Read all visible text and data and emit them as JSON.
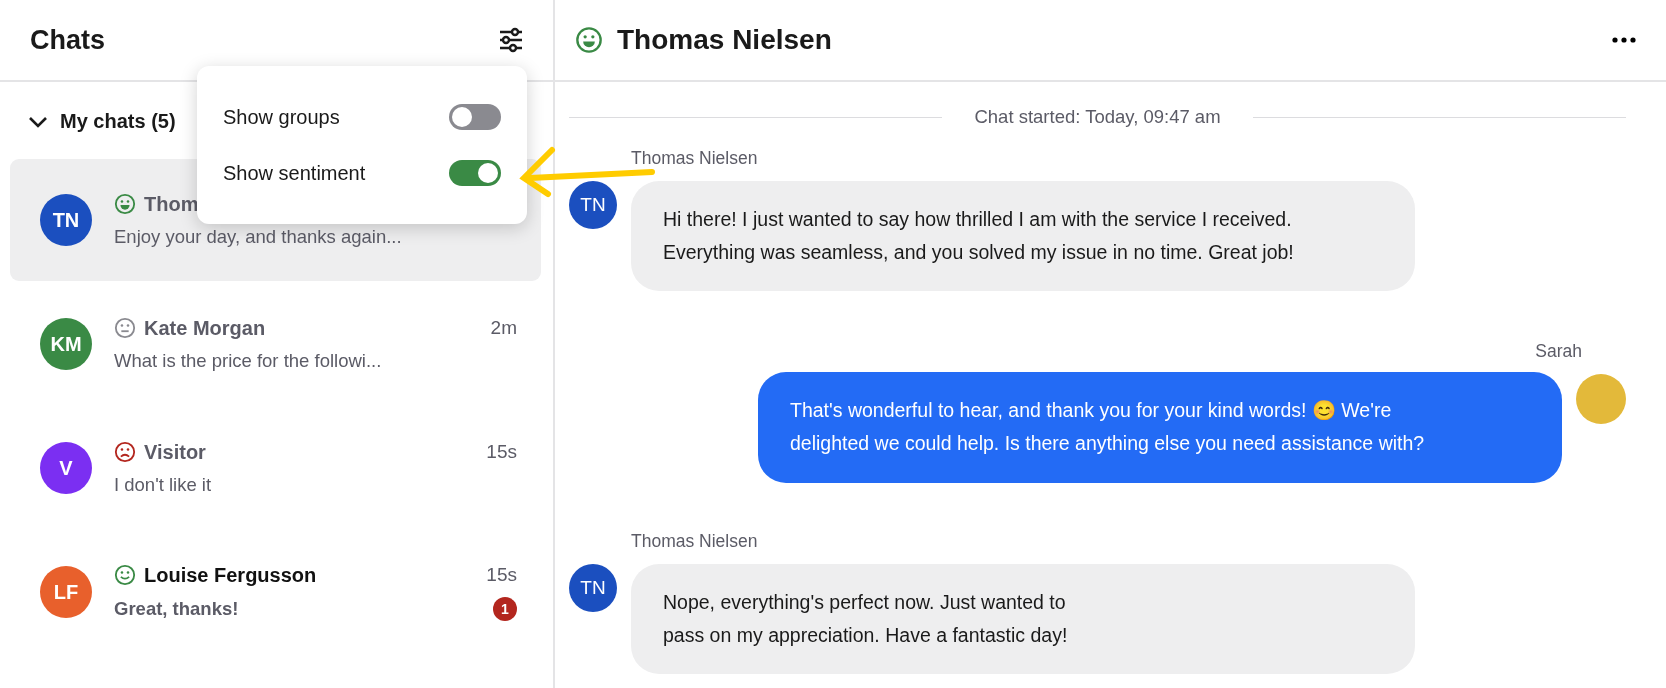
{
  "sidebar": {
    "title": "Chats",
    "group": {
      "label": "My chats (5)",
      "expanded": true
    },
    "chats": [
      {
        "initials": "TN",
        "color": "#1b4fbf",
        "sentiment_icon": {
          "kind": "happy"
        },
        "name": "Thom",
        "preview": "Enjoy your day, and thanks again...",
        "selected": true,
        "unread": false
      },
      {
        "initials": "KM",
        "color": "#3a8a45",
        "sentiment_icon": {
          "kind": "neutral"
        },
        "name": "Kate Morgan",
        "time": "2m",
        "preview": "What is the price for the followi...",
        "selected": false,
        "unread": false
      },
      {
        "initials": "V",
        "color": "#7b2ff2",
        "sentiment_icon": {
          "kind": "sad"
        },
        "name": "Visitor",
        "time": "15s",
        "preview": "I don't like it",
        "selected": false,
        "unread": false
      },
      {
        "initials": "LF",
        "color": "#e8602c",
        "sentiment_icon": {
          "kind": "smile"
        },
        "name": "Louise Fergusson",
        "time": "15s",
        "preview": "Great, thanks!",
        "selected": false,
        "unread": true,
        "badge": "1"
      }
    ]
  },
  "popup": {
    "options": [
      {
        "label": "Show groups",
        "on": false
      },
      {
        "label": "Show sentiment",
        "on": true
      }
    ]
  },
  "conversation": {
    "sentiment_icon": {
      "kind": "happy"
    },
    "title": "Thomas  Nielsen",
    "started": "Chat started: Today, 09:47 am",
    "messages": [
      {
        "kind": "incoming",
        "sender": "Thomas  Nielsen",
        "initials": "TN",
        "text": "Hi there! I just wanted to say how thrilled I am with the service I received. Everything was seamless, and you solved my issue in no time. Great job!"
      },
      {
        "kind": "outgoing",
        "sender": "Sarah",
        "text": "That's wonderful to hear, and thank you for your kind words! 😊 We're delighted we could help. Is there anything else you need assistance with?"
      },
      {
        "kind": "incoming",
        "sender": "Thomas  Nielsen",
        "initials": "TN",
        "text": "Nope, everything's perfect now. Just wanted to pass on my appreciation. Have a fantastic day!"
      }
    ]
  }
}
